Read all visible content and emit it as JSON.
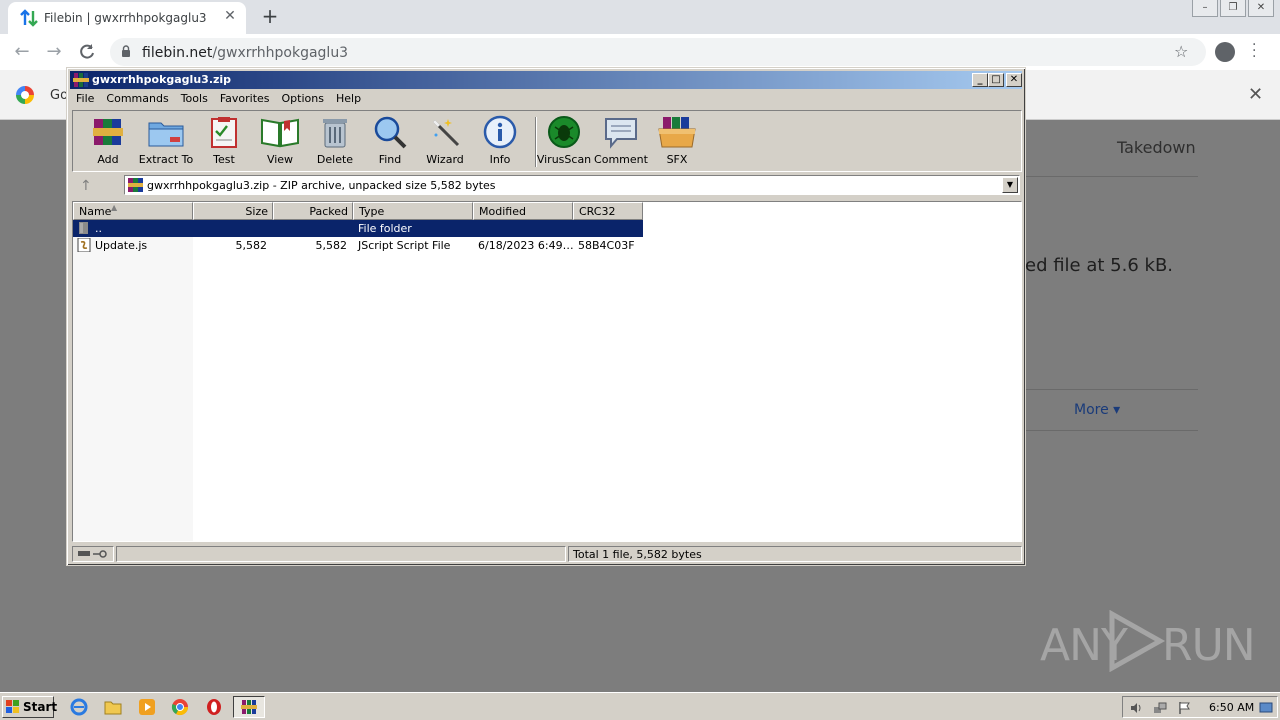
{
  "browser": {
    "tab_title": "Filebin | gwxrrhhpokgaglu3",
    "tab_close": "✕",
    "new_tab": "+",
    "url_domain": "filebin.net",
    "url_path": "/gwxrrhhpokgaglu3",
    "infobar_text": "Go",
    "infobar_close": "✕",
    "star_icon": "☆"
  },
  "page": {
    "takedown": "Takedown",
    "partial_text": "ed file at 5.6 kB.",
    "more": "More ▾"
  },
  "watermark": {
    "text_any": "ANY",
    "text_run": "RUN"
  },
  "winrar": {
    "title": "gwxrrhhpokgaglu3.zip",
    "menu": [
      "File",
      "Commands",
      "Tools",
      "Favorites",
      "Options",
      "Help"
    ],
    "toolbar": [
      "Add",
      "Extract To",
      "Test",
      "View",
      "Delete",
      "Find",
      "Wizard",
      "Info",
      "VirusScan",
      "Comment",
      "SFX"
    ],
    "address": "gwxrrhhpokgaglu3.zip - ZIP archive, unpacked size 5,582 bytes",
    "columns": [
      "Name",
      "Size",
      "Packed",
      "Type",
      "Modified",
      "CRC32"
    ],
    "rows": [
      {
        "name": "..",
        "size": "",
        "packed": "",
        "type": "File folder",
        "modified": "",
        "crc": ""
      },
      {
        "name": "Update.js",
        "size": "5,582",
        "packed": "5,582",
        "type": "JScript Script File",
        "modified": "6/18/2023 6:49…",
        "crc": "58B4C03F"
      }
    ],
    "status": "Total 1 file, 5,582 bytes"
  },
  "taskbar": {
    "start": "Start",
    "clock": "6:50 AM"
  }
}
